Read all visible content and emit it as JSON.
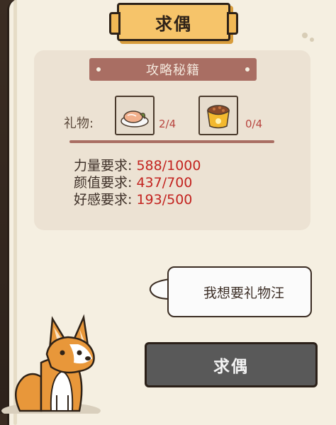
{
  "title": "求偶",
  "section_header": "攻略秘籍",
  "gifts": {
    "label": "礼物:",
    "items": [
      {
        "icon": "fish-plate-icon",
        "count": "2/4"
      },
      {
        "icon": "pet-food-bowl-icon",
        "count": "0/4"
      }
    ]
  },
  "requirements": [
    {
      "label": "力量要求:",
      "value": "588/1000"
    },
    {
      "label": "颜值要求:",
      "value": "437/700"
    },
    {
      "label": "好感要求:",
      "value": "193/500"
    }
  ],
  "speech_bubble": "我想要礼物汪",
  "action_button": "求偶",
  "colors": {
    "parchment": "#f5efe1",
    "panel": "#ece2d3",
    "ribbon": "#a96e63",
    "plaque": "#f6c46a",
    "value_red": "#c3231f",
    "button": "#595959"
  }
}
